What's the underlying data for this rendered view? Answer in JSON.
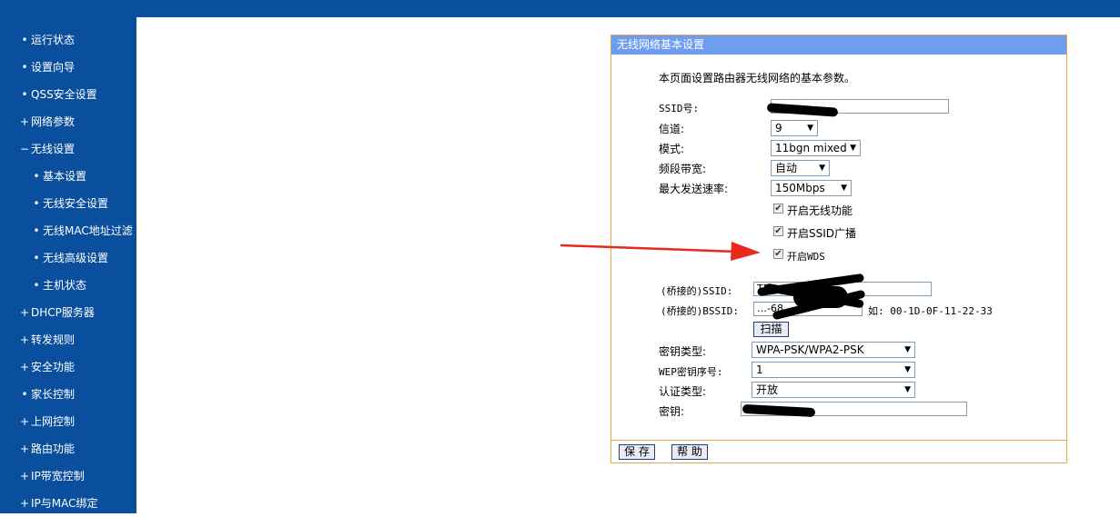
{
  "nav": {
    "items": [
      {
        "marker": "•",
        "label": "运行状态"
      },
      {
        "marker": "•",
        "label": "设置向导"
      },
      {
        "marker": "•",
        "label": "QSS安全设置"
      },
      {
        "marker": "+",
        "label": "网络参数"
      },
      {
        "marker": "−",
        "label": "无线设置"
      },
      {
        "marker": "•",
        "label": "基本设置"
      },
      {
        "marker": "•",
        "label": "无线安全设置"
      },
      {
        "marker": "•",
        "label": "无线MAC地址过滤"
      },
      {
        "marker": "•",
        "label": "无线高级设置"
      },
      {
        "marker": "•",
        "label": "主机状态"
      },
      {
        "marker": "+",
        "label": "DHCP服务器"
      },
      {
        "marker": "+",
        "label": "转发规则"
      },
      {
        "marker": "+",
        "label": "安全功能"
      },
      {
        "marker": "•",
        "label": "家长控制"
      },
      {
        "marker": "+",
        "label": "上网控制"
      },
      {
        "marker": "+",
        "label": "路由功能"
      },
      {
        "marker": "+",
        "label": "IP带宽控制"
      },
      {
        "marker": "+",
        "label": "IP与MAC绑定"
      }
    ]
  },
  "panel": {
    "title": "无线网络基本设置",
    "intro": "本页面设置路由器无线网络的基本参数。",
    "ssid_label": "SSID号:",
    "ssid_value": "",
    "channel_label": "信道:",
    "channel_value": "9",
    "mode_label": "模式:",
    "mode_value": "11bgn mixed",
    "bandwidth_label": "频段带宽:",
    "bandwidth_value": "自动",
    "max_rate_label": "最大发送速率:",
    "max_rate_value": "150Mbps",
    "enable_wireless": "开启无线功能",
    "enable_ssid_broadcast": "开启SSID广播",
    "enable_wds": "开启WDS",
    "bridge_ssid_label": "(桥接的)SSID:",
    "bridge_ssid_value": "TP-L",
    "bridge_bssid_label": "(桥接的)BSSID:",
    "bridge_bssid_value": "…-68",
    "bssid_example": "如: 00-1D-0F-11-22-33",
    "scan_button": "扫描",
    "key_type_label": "密钥类型:",
    "key_type_value": "WPA-PSK/WPA2-PSK",
    "wep_index_label": "WEP密钥序号:",
    "wep_index_value": "1",
    "auth_type_label": "认证类型:",
    "auth_type_value": "开放",
    "key_label": "密钥:",
    "key_value": "",
    "save_button": "保 存",
    "help_button": "帮 助"
  },
  "colors": {
    "sidebar": "#0a4f9e",
    "panel_title_bg": "#6e9df0",
    "panel_border": "#f2a64c",
    "arrow": "#e8281e"
  }
}
